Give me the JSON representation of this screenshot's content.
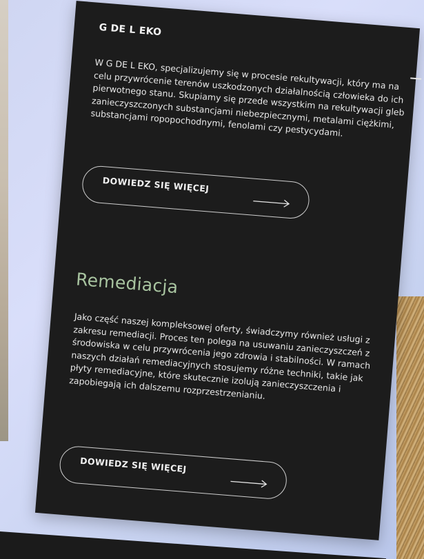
{
  "brand": {
    "logo_text": "G DE L EKO"
  },
  "section1": {
    "text": "W G DE L EKO, specjalizujemy się w procesie rekultywacji, który ma na celu przywrócenie terenów uszkodzonych działalnością człowieka do ich pierwotnego stanu. Skupiamy się przede wszystkim na rekultywacji gleb zanieczyszczonych substancjami niebezpiecznymi, metalami ciężkimi, substancjami ropopochodnymi, fenolami czy pestycydami.",
    "cta_label": "DOWIEDZ SIĘ WIĘCEJ"
  },
  "section2": {
    "heading": "Remediacja",
    "text": "Jako część naszej kompleksowej oferty, świadczymy również usługi z zakresu remediacji. Proces ten polega na usuwaniu zanieczyszczeń z środowiska w celu przywrócenia jego zdrowia i stabilności. W ramach naszych działań remediacyjnych stosujemy różne techniki, takie jak płyty remediacyjne, które skutecznie izolują zanieczyszczenia i zapobiegają ich dalszemu rozprzestrzenianiu.",
    "cta_label": "DOWIEDZ SIĘ WIĘCEJ"
  },
  "colors": {
    "card_background": "#1c1c1c",
    "heading_accent": "#a8c4a0",
    "page_background": "#d3daf5"
  },
  "icons": {
    "cta_arrow": "arrow-right-icon",
    "menu": "menu-icon"
  }
}
